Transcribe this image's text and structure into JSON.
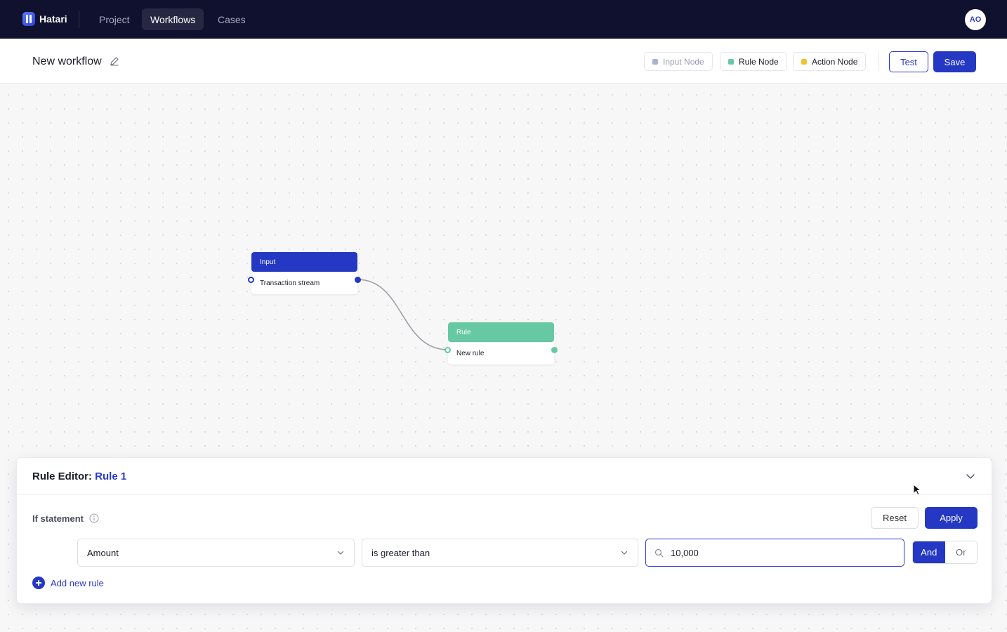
{
  "topnav": {
    "brand": "Hatari",
    "items": [
      {
        "label": "Project",
        "active": false
      },
      {
        "label": "Workflows",
        "active": true
      },
      {
        "label": "Cases",
        "active": false
      }
    ],
    "avatar_initials": "AO"
  },
  "header": {
    "title": "New workflow",
    "legend": [
      {
        "label": "Input Node",
        "color": "#a9b1d6",
        "muted": true
      },
      {
        "label": "Rule Node",
        "color": "#67c9a4",
        "muted": false
      },
      {
        "label": "Action Node",
        "color": "#f2c230",
        "muted": false
      }
    ],
    "test_label": "Test",
    "save_label": "Save"
  },
  "canvas": {
    "nodes": [
      {
        "type": "Input",
        "label": "Transaction stream",
        "color": "#2438c4"
      },
      {
        "type": "Rule",
        "label": "New rule",
        "color": "#67c9a4"
      }
    ]
  },
  "rule_editor": {
    "title_prefix": "Rule Editor:",
    "rule_name": "Rule 1",
    "if_label": "If statement",
    "reset_label": "Reset",
    "apply_label": "Apply",
    "condition": {
      "field": "Amount",
      "operator": "is greater than",
      "value": "10,000"
    },
    "logic": {
      "and_label": "And",
      "or_label": "Or",
      "selected": "And"
    },
    "add_rule_label": "Add new rule"
  }
}
